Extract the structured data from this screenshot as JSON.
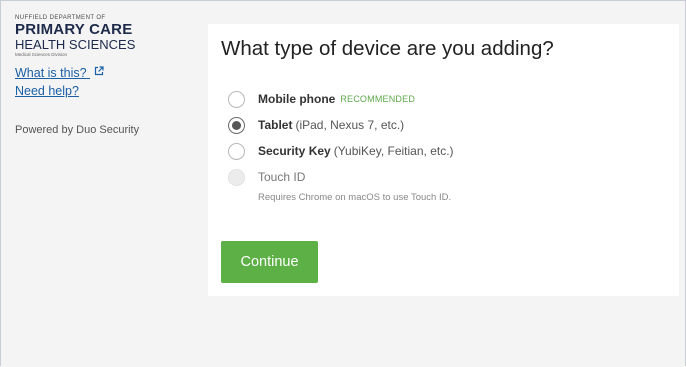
{
  "sidebar": {
    "logo": {
      "dept": "NUFFIELD DEPARTMENT OF",
      "title": "PRIMARY CARE",
      "subtitle": "HEALTH SCIENCES",
      "division": "Medical Sciences Division"
    },
    "what_is_this": "What is this?",
    "need_help": "Need help?",
    "powered_by": "Powered by Duo Security"
  },
  "main": {
    "heading": "What type of device are you adding?",
    "options": [
      {
        "name": "Mobile phone",
        "detail": "",
        "badge": "RECOMMENDED",
        "selected": false,
        "disabled": false
      },
      {
        "name": "Tablet",
        "detail": "(iPad, Nexus 7, etc.)",
        "badge": "",
        "selected": true,
        "disabled": false
      },
      {
        "name": "Security Key",
        "detail": "(YubiKey, Feitian, etc.)",
        "badge": "",
        "selected": false,
        "disabled": false
      },
      {
        "name": "Touch ID",
        "detail": "",
        "badge": "",
        "selected": false,
        "disabled": true,
        "hint": "Requires Chrome on macOS to use Touch ID."
      }
    ],
    "continue_label": "Continue"
  },
  "colors": {
    "accent_green": "#5cb046",
    "link_blue": "#1a5fa6",
    "recommended_green": "#5ea84a"
  },
  "icons": {
    "external_link": "external-link-icon"
  }
}
